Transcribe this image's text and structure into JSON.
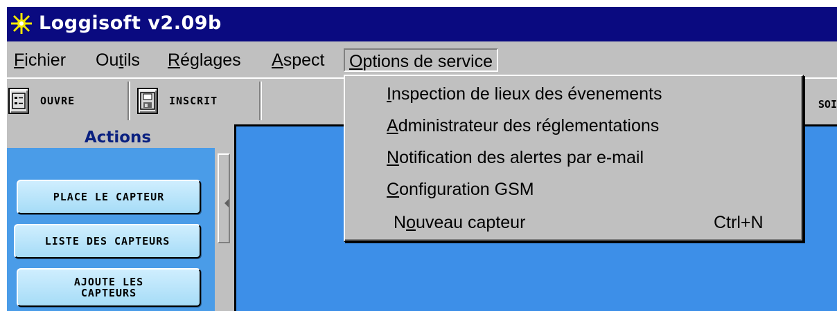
{
  "window": {
    "title": "Loggisoft v2.09b",
    "icon": "sun-star-icon"
  },
  "menubar": {
    "items": [
      {
        "pre": "",
        "key": "F",
        "post": "ichier"
      },
      {
        "pre": "Ou",
        "key": "t",
        "post": "ils"
      },
      {
        "pre": "",
        "key": "R",
        "post": "églages"
      },
      {
        "pre": "",
        "key": "A",
        "post": "spect"
      },
      {
        "pre": "",
        "key": "O",
        "post": "ptions de service"
      }
    ]
  },
  "toolbar": {
    "open_label": "OUVRE",
    "save_label": "INSCRIT",
    "right_partial": "SOI"
  },
  "actions": {
    "header": "Actions",
    "buttons": [
      "PLACE LE CAPTEUR",
      "LISTE DES CAPTEURS",
      "AJOUTE LES CAPTEURS"
    ]
  },
  "dropdown": {
    "items": [
      {
        "key": "I",
        "rest": "nspection de lieux des évenements",
        "shortcut": ""
      },
      {
        "key": "A",
        "rest": "dministrateur des réglementations",
        "shortcut": ""
      },
      {
        "key": "N",
        "rest": "otification des alertes par e-mail",
        "shortcut": ""
      },
      {
        "key": "C",
        "rest": "onfiguration GSM",
        "shortcut": ""
      },
      {
        "pre": "N",
        "key": "o",
        "rest": "uveau capteur",
        "shortcut": "Ctrl+N"
      }
    ]
  },
  "colors": {
    "titlebar": "#0a0a80",
    "workspace": "#3d8fe8",
    "actions_area": "#4a9ce8",
    "button_face": "#c0c0c0"
  }
}
